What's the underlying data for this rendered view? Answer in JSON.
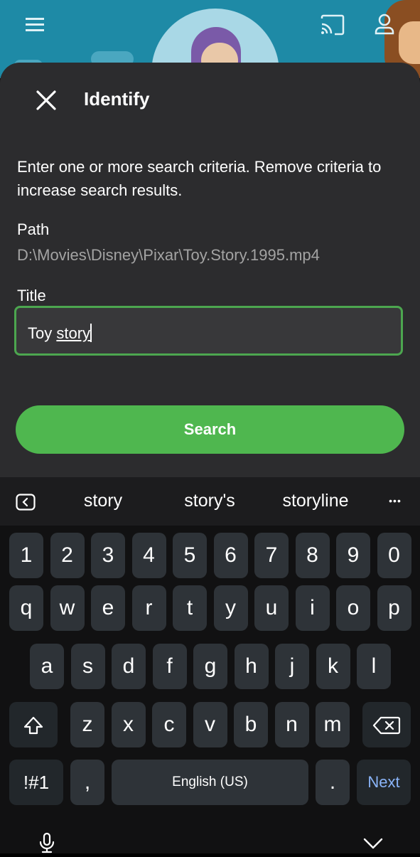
{
  "header": {
    "menu_icon": "hamburger-menu-icon",
    "cast_icon": "cast-icon",
    "profile_icon": "profile-icon"
  },
  "dialog": {
    "title": "Identify",
    "close_icon": "close-icon",
    "instructions": "Enter one or more search criteria. Remove criteria to increase search results.",
    "path_label": "Path",
    "path_value": "D:\\Movies\\Disney\\Pixar\\Toy.Story.1995.mp4",
    "title_label": "Title",
    "title_value_plain": "Toy ",
    "title_value_composing": "story",
    "search_label": "Search",
    "accent_color": "#4fb74f"
  },
  "keyboard": {
    "suggestions": [
      "story",
      "story's",
      "storyline"
    ],
    "more_label": "•••",
    "row_numbers": [
      "1",
      "2",
      "3",
      "4",
      "5",
      "6",
      "7",
      "8",
      "9",
      "0"
    ],
    "row_q": [
      "q",
      "w",
      "e",
      "r",
      "t",
      "y",
      "u",
      "i",
      "o",
      "p"
    ],
    "row_a": [
      "a",
      "s",
      "d",
      "f",
      "g",
      "h",
      "j",
      "k",
      "l"
    ],
    "row_z": [
      "z",
      "x",
      "c",
      "v",
      "b",
      "n",
      "m"
    ],
    "symbols_label": "!#1",
    "comma_label": ",",
    "space_label": "English (US)",
    "period_label": ".",
    "next_label": "Next",
    "next_color": "#8ab4f8"
  }
}
